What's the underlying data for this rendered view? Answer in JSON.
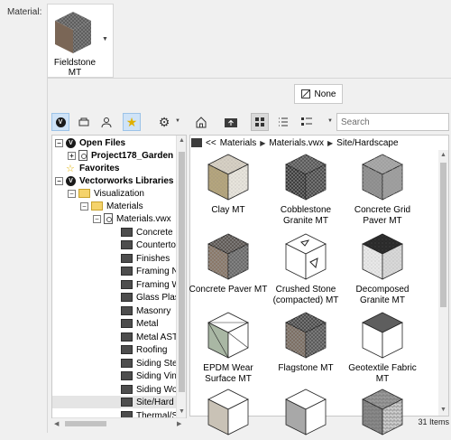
{
  "material_label": "Material:",
  "current_material": {
    "name_line1": "Fieldstone",
    "name_line2": "MT"
  },
  "none_button": "None",
  "search": {
    "placeholder": "Search"
  },
  "breadcrumb": [
    "<<",
    "Materials",
    "Materials.vwx",
    "Site/Hardscape"
  ],
  "tree": [
    {
      "label": "Open Files"
    },
    {
      "label": "Project178_Garden"
    },
    {
      "label": "Favorites"
    },
    {
      "label": "Vectorworks Libraries"
    },
    {
      "label": "Visualization"
    },
    {
      "label": "Materials"
    },
    {
      "label": "Materials.vwx"
    },
    {
      "label": "Concrete"
    },
    {
      "label": "Countertop"
    },
    {
      "label": "Finishes"
    },
    {
      "label": "Framing N"
    },
    {
      "label": "Framing W"
    },
    {
      "label": "Glass Plas"
    },
    {
      "label": "Masonry"
    },
    {
      "label": "Metal"
    },
    {
      "label": "Metal AST"
    },
    {
      "label": "Roofing"
    },
    {
      "label": "Siding Ste"
    },
    {
      "label": "Siding Vin"
    },
    {
      "label": "Siding Wo"
    },
    {
      "label": "Site/Hard"
    },
    {
      "label": "Thermal/S"
    }
  ],
  "items": [
    {
      "line1": "Clay MT",
      "line2": "",
      "top": "#d6d0c4",
      "left": "#b4a57e",
      "right": "#e7e4dc",
      "pattern": "speckle"
    },
    {
      "line1": "Cobblestone",
      "line2": "Granite MT",
      "top": "#5a5a5a",
      "left": "#3e3e3e",
      "right": "#4f4f4f",
      "pattern": "grid"
    },
    {
      "line1": "Concrete Grid",
      "line2": "Paver MT",
      "top": "#a9a9a9",
      "left": "#8d8d8d",
      "right": "#9f9f9f",
      "pattern": "grid"
    },
    {
      "line1": "Concrete Paver MT",
      "line2": "",
      "top": "#5f5955",
      "left": "#8a7868",
      "right": "#6c6c6c",
      "pattern": "grid"
    },
    {
      "line1": "Crushed Stone",
      "line2": "(compacted) MT",
      "top": "#ffffff",
      "left": "#ffffff",
      "right": "#ffffff",
      "pattern": "triangle"
    },
    {
      "line1": "Decomposed",
      "line2": "Granite MT",
      "top": "#2a2a2a",
      "left": "#e8e8e8",
      "right": "#d8d8d8",
      "pattern": "speckle"
    },
    {
      "line1": "EPDM Wear",
      "line2": "Surface MT",
      "top": "#ffffff",
      "left": "#a9b7a4",
      "right": "#ffffff",
      "pattern": "diag"
    },
    {
      "line1": "Flagstone MT",
      "line2": "",
      "top": "#4e4e4e",
      "left": "#7d6f63",
      "right": "#5b5b5b",
      "pattern": "grid"
    },
    {
      "line1": "Geotextile Fabric",
      "line2": "MT",
      "top": "#5e5e5e",
      "left": "#ffffff",
      "right": "#ffffff",
      "pattern": "plain"
    },
    {
      "line1": "",
      "line2": "",
      "top": "#ffffff",
      "left": "#c9c2b6",
      "right": "#ffffff",
      "pattern": "plain"
    },
    {
      "line1": "",
      "line2": "",
      "top": "#ffffff",
      "left": "#a8a8a8",
      "right": "#ffffff",
      "pattern": "plain"
    },
    {
      "line1": "",
      "line2": "",
      "top": "#9a9a9a",
      "left": "#8a8a8a",
      "right": "#cfcfcf",
      "pattern": "brick"
    }
  ],
  "status": "31 Items",
  "colors": {
    "accent": "#cfe3f7",
    "folder": "#f5d36b"
  }
}
